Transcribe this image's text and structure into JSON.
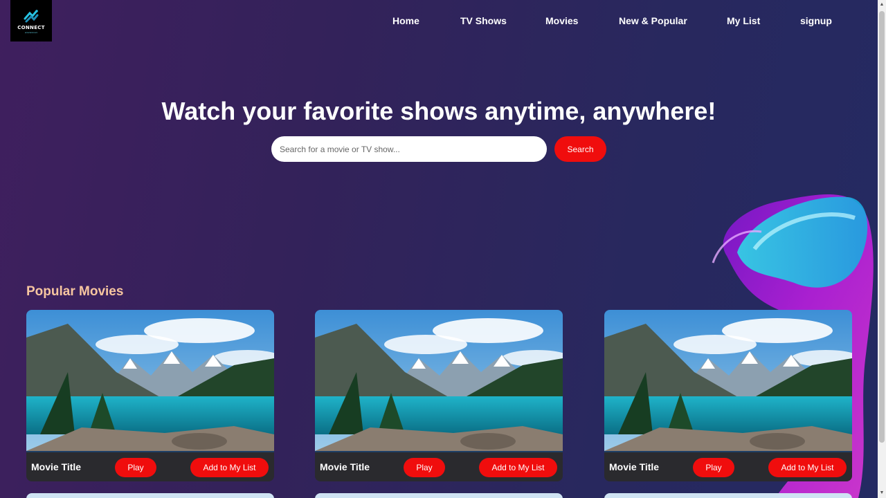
{
  "brand": {
    "logo_text": "CONNECT",
    "tagline": "entertainment"
  },
  "nav": {
    "items": [
      {
        "label": "Home"
      },
      {
        "label": "TV Shows"
      },
      {
        "label": "Movies"
      },
      {
        "label": "New & Popular"
      },
      {
        "label": "My List"
      },
      {
        "label": "signup"
      }
    ]
  },
  "hero": {
    "title": "Watch your favorite shows anytime, anywhere!",
    "search_placeholder": "Search for a movie or TV show...",
    "search_value": "",
    "search_button": "Search"
  },
  "popular": {
    "heading": "Popular Movies",
    "cards": [
      {
        "title": "Movie Title",
        "play_label": "Play",
        "add_label": "Add to My List"
      },
      {
        "title": "Movie Title",
        "play_label": "Play",
        "add_label": "Add to My List"
      },
      {
        "title": "Movie Title",
        "play_label": "Play",
        "add_label": "Add to My List"
      }
    ]
  },
  "colors": {
    "accent": "#f00d0d",
    "heading": "#f7c6a0",
    "card_bar": "#2a2a2e"
  },
  "icons": {
    "scroll_up": "arrow-up-icon",
    "scroll_down": "arrow-down-icon"
  }
}
